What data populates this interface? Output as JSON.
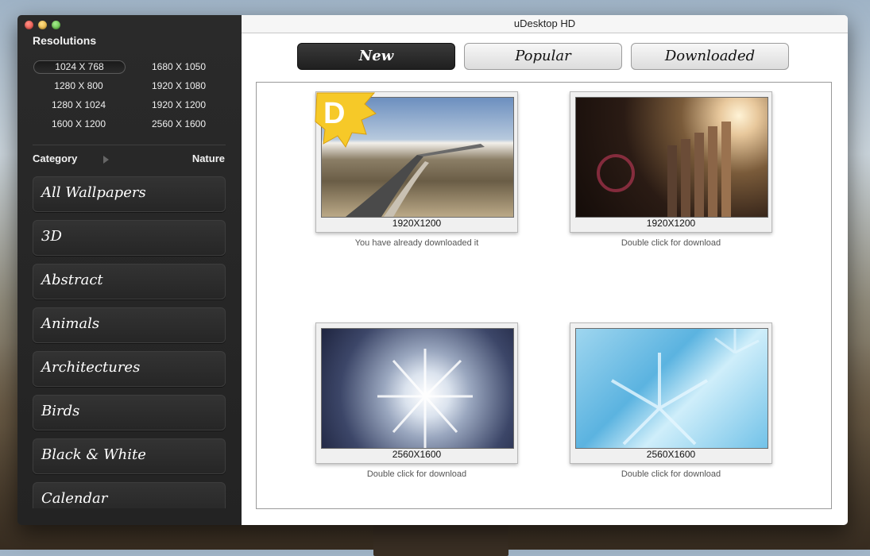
{
  "window": {
    "title": "uDesktop  HD"
  },
  "sidebar": {
    "resolutions_heading": "Resolutions",
    "resolutions": [
      {
        "label": "1024 X 768",
        "selected": true
      },
      {
        "label": "1680 X 1050",
        "selected": false
      },
      {
        "label": "1280 X 800",
        "selected": false
      },
      {
        "label": "1920 X 1080",
        "selected": false
      },
      {
        "label": "1280 X 1024",
        "selected": false
      },
      {
        "label": "1920 X 1200",
        "selected": false
      },
      {
        "label": "1600 X 1200",
        "selected": false
      },
      {
        "label": "2560 X 1600",
        "selected": false
      }
    ],
    "category_label": "Category",
    "category_value": "Nature",
    "categories": [
      "All Wallpapers",
      "3D",
      "Abstract",
      "Animals",
      "Architectures",
      "Birds",
      "Black & White",
      "Calendar"
    ]
  },
  "tabs": [
    {
      "label": "New",
      "active": true
    },
    {
      "label": "Popular",
      "active": false
    },
    {
      "label": "Downloaded",
      "active": false
    }
  ],
  "gallery": [
    {
      "resolution": "1920X1200",
      "status": "You have already downloaded it",
      "badge": "D",
      "thumb": "road-guardrail-icon"
    },
    {
      "resolution": "1920X1200",
      "status": "Double click for download",
      "badge": null,
      "thumb": "wooden-fence-sunset-icon"
    },
    {
      "resolution": "2560X1600",
      "status": "Double click for download",
      "badge": null,
      "thumb": "frosted-plant-icon"
    },
    {
      "resolution": "2560X1600",
      "status": "Double click for download",
      "badge": null,
      "thumb": "snowflake-icon"
    }
  ],
  "colors": {
    "sidebar_bg": "#262626",
    "badge_yellow": "#f6c928",
    "active_tab": "#2a2a2a"
  }
}
